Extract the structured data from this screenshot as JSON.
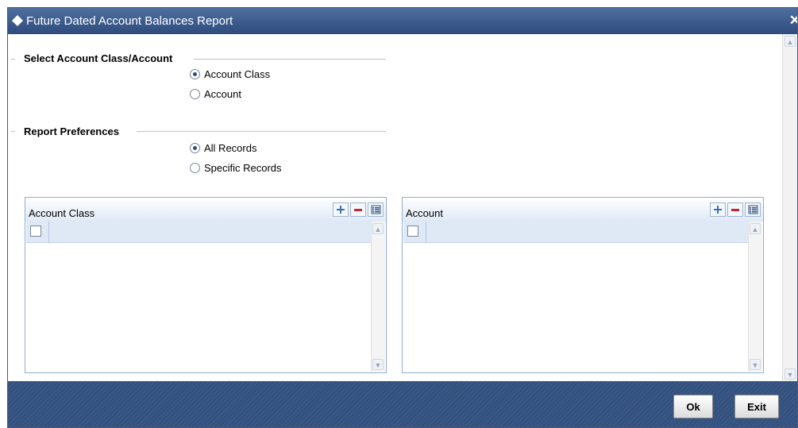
{
  "window": {
    "title": "Future Dated Account Balances Report"
  },
  "section_account": {
    "legend": "Select Account Class/Account",
    "options": [
      {
        "label": "Account Class",
        "checked": true
      },
      {
        "label": "Account",
        "checked": false
      }
    ]
  },
  "section_preferences": {
    "legend": "Report Preferences",
    "options": [
      {
        "label": "All Records",
        "checked": true
      },
      {
        "label": "Specific Records",
        "checked": false
      }
    ]
  },
  "grids": {
    "account_class": {
      "title": "Account Class"
    },
    "account": {
      "title": "Account"
    }
  },
  "footer": {
    "ok_label": "Ok",
    "exit_label": "Exit"
  },
  "colors": {
    "titlebar": "#3c5a8a",
    "footer": "#33507c",
    "grid_border": "#8eaed3"
  }
}
